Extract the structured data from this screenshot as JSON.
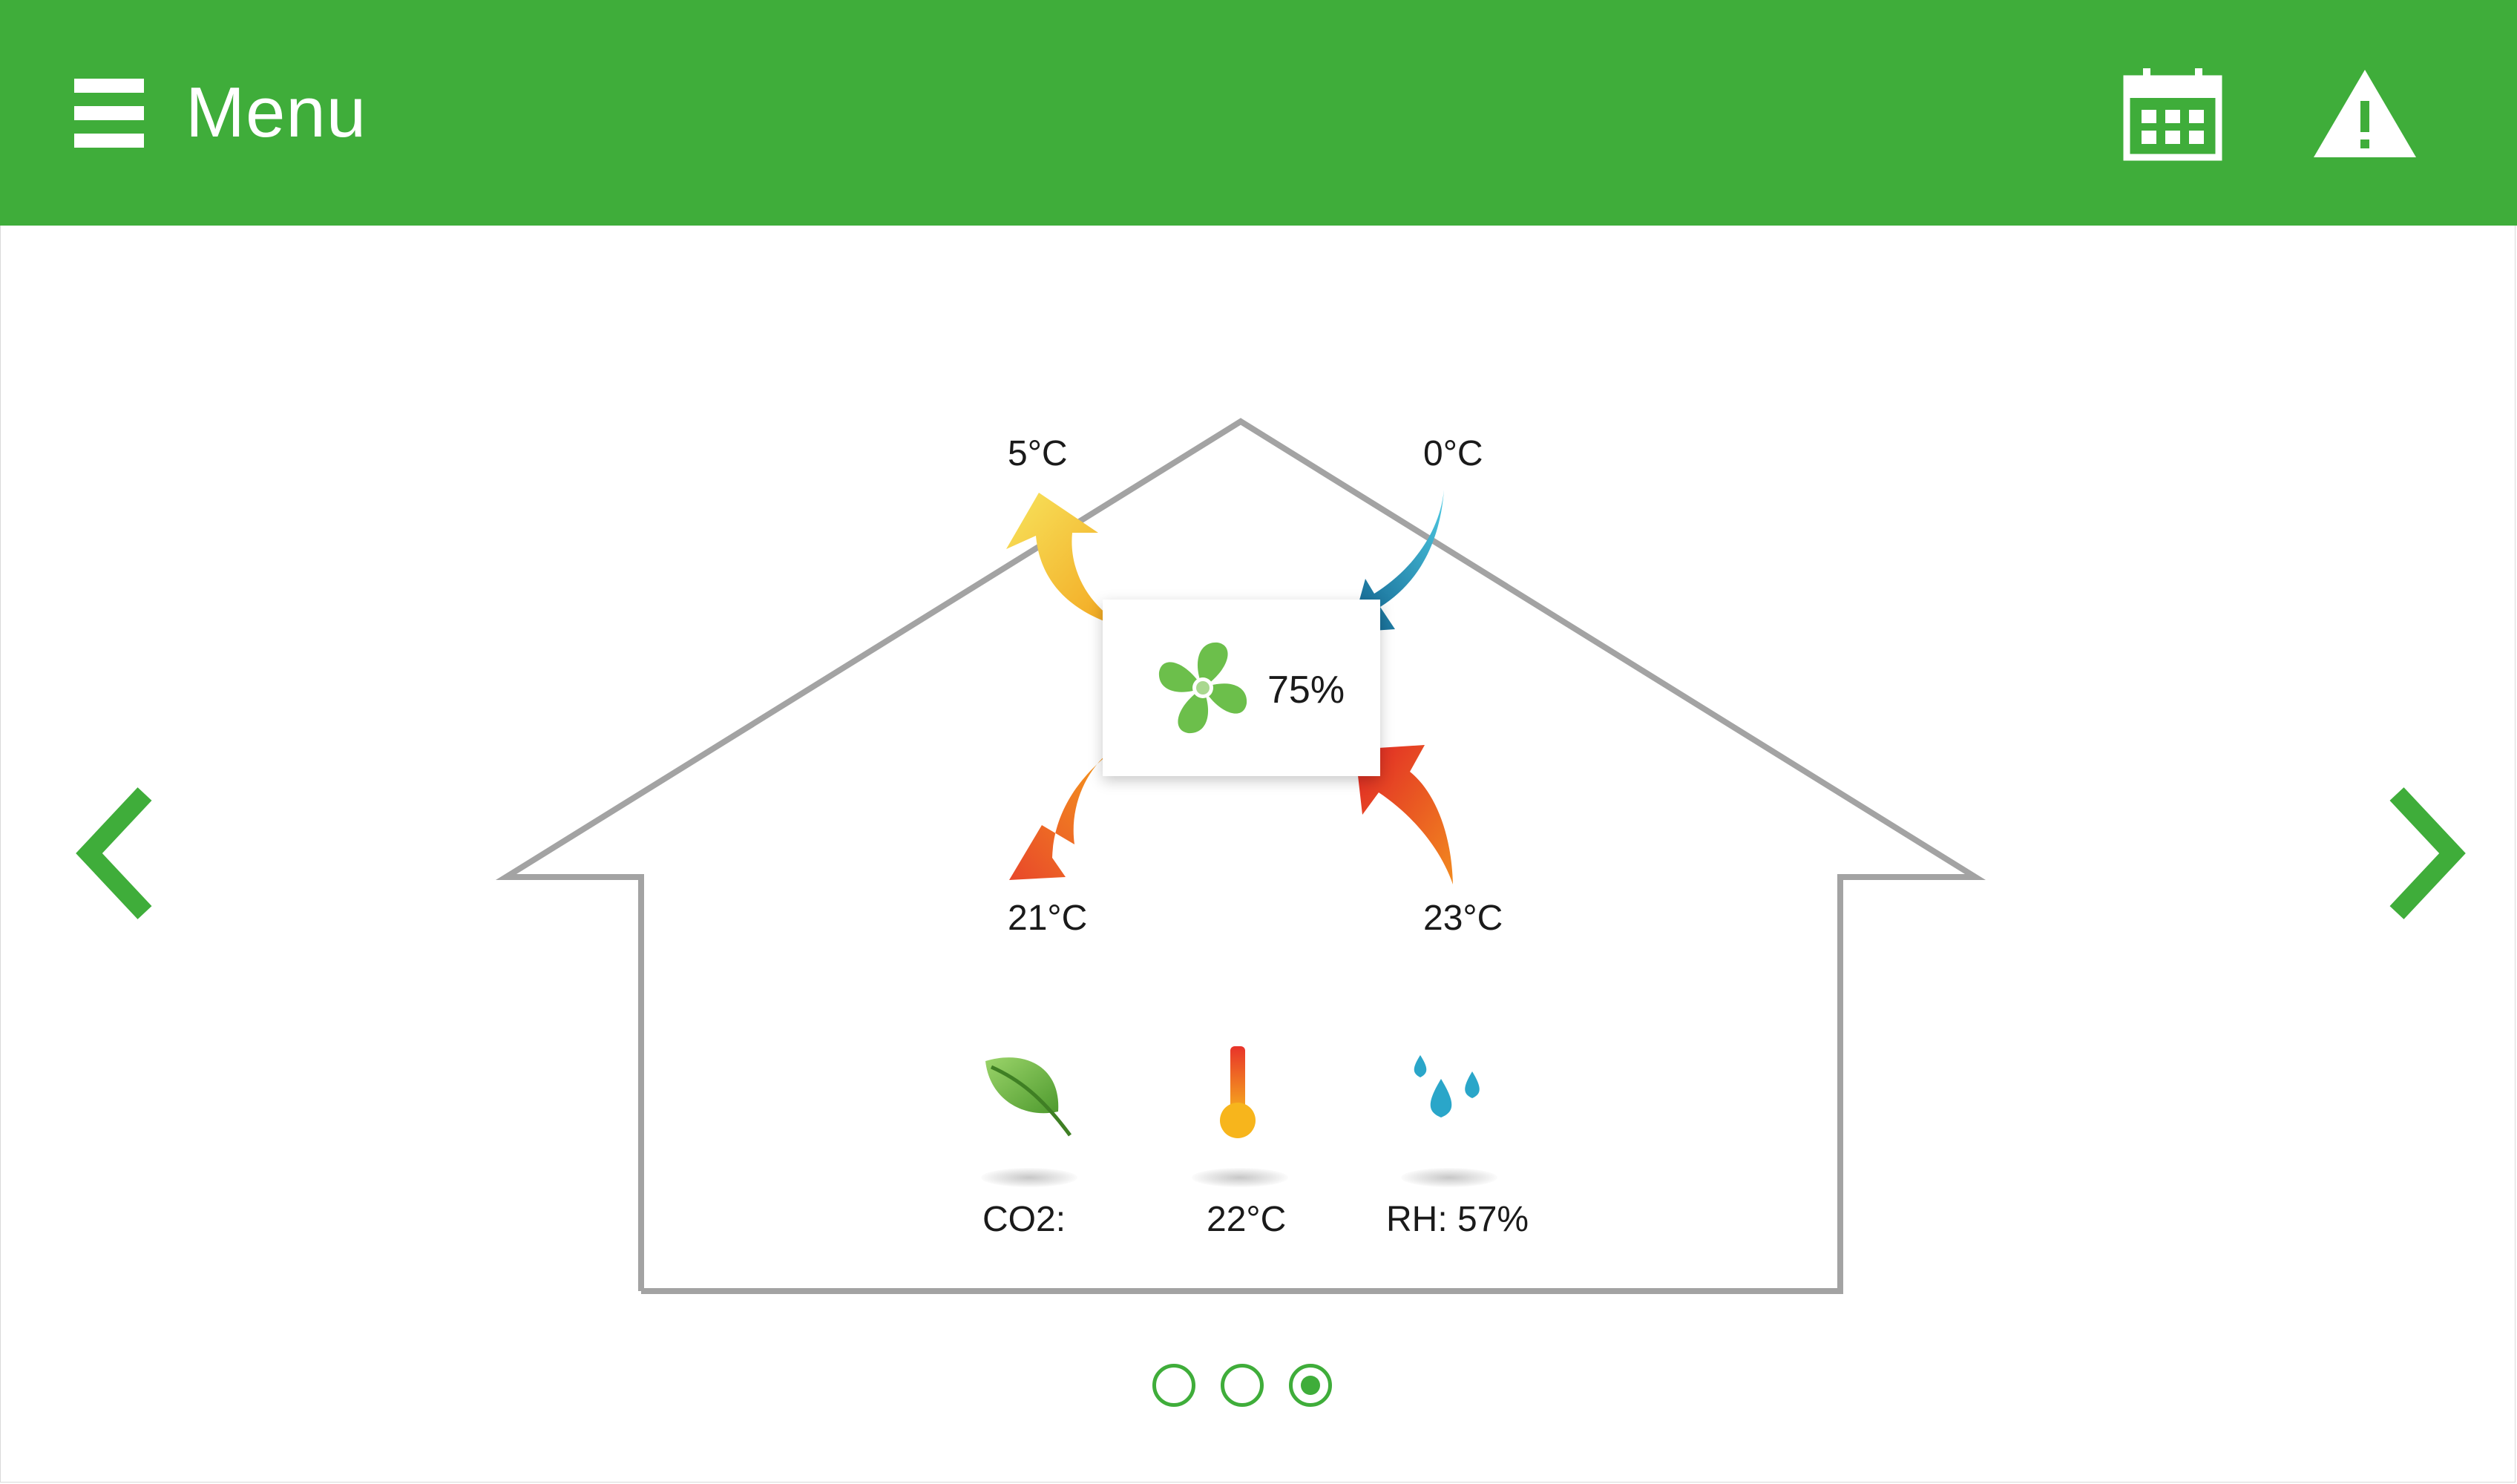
{
  "header": {
    "menu_label": "Menu",
    "calendar_icon": "calendar-icon",
    "alert_icon": "warning-icon"
  },
  "colors": {
    "brand_green": "#3fad3a",
    "house_outline": "#a3a3a3",
    "supply_air": "#f2c62f",
    "outdoor_air": "#2bb3d4",
    "exhaust_air": "#ef7b1f",
    "extract_air": "#e8332a"
  },
  "ventilation": {
    "outdoor_air_temp": "0°C",
    "exhaust_air_temp": "5°C",
    "supply_air_temp": "21°C",
    "extract_air_temp": "23°C",
    "fan_speed": "75%"
  },
  "sensors": {
    "co2_label": "CO2:",
    "temperature": "22°C",
    "humidity": "RH: 57%"
  },
  "pager": {
    "pages": 3,
    "active_index": 2
  }
}
